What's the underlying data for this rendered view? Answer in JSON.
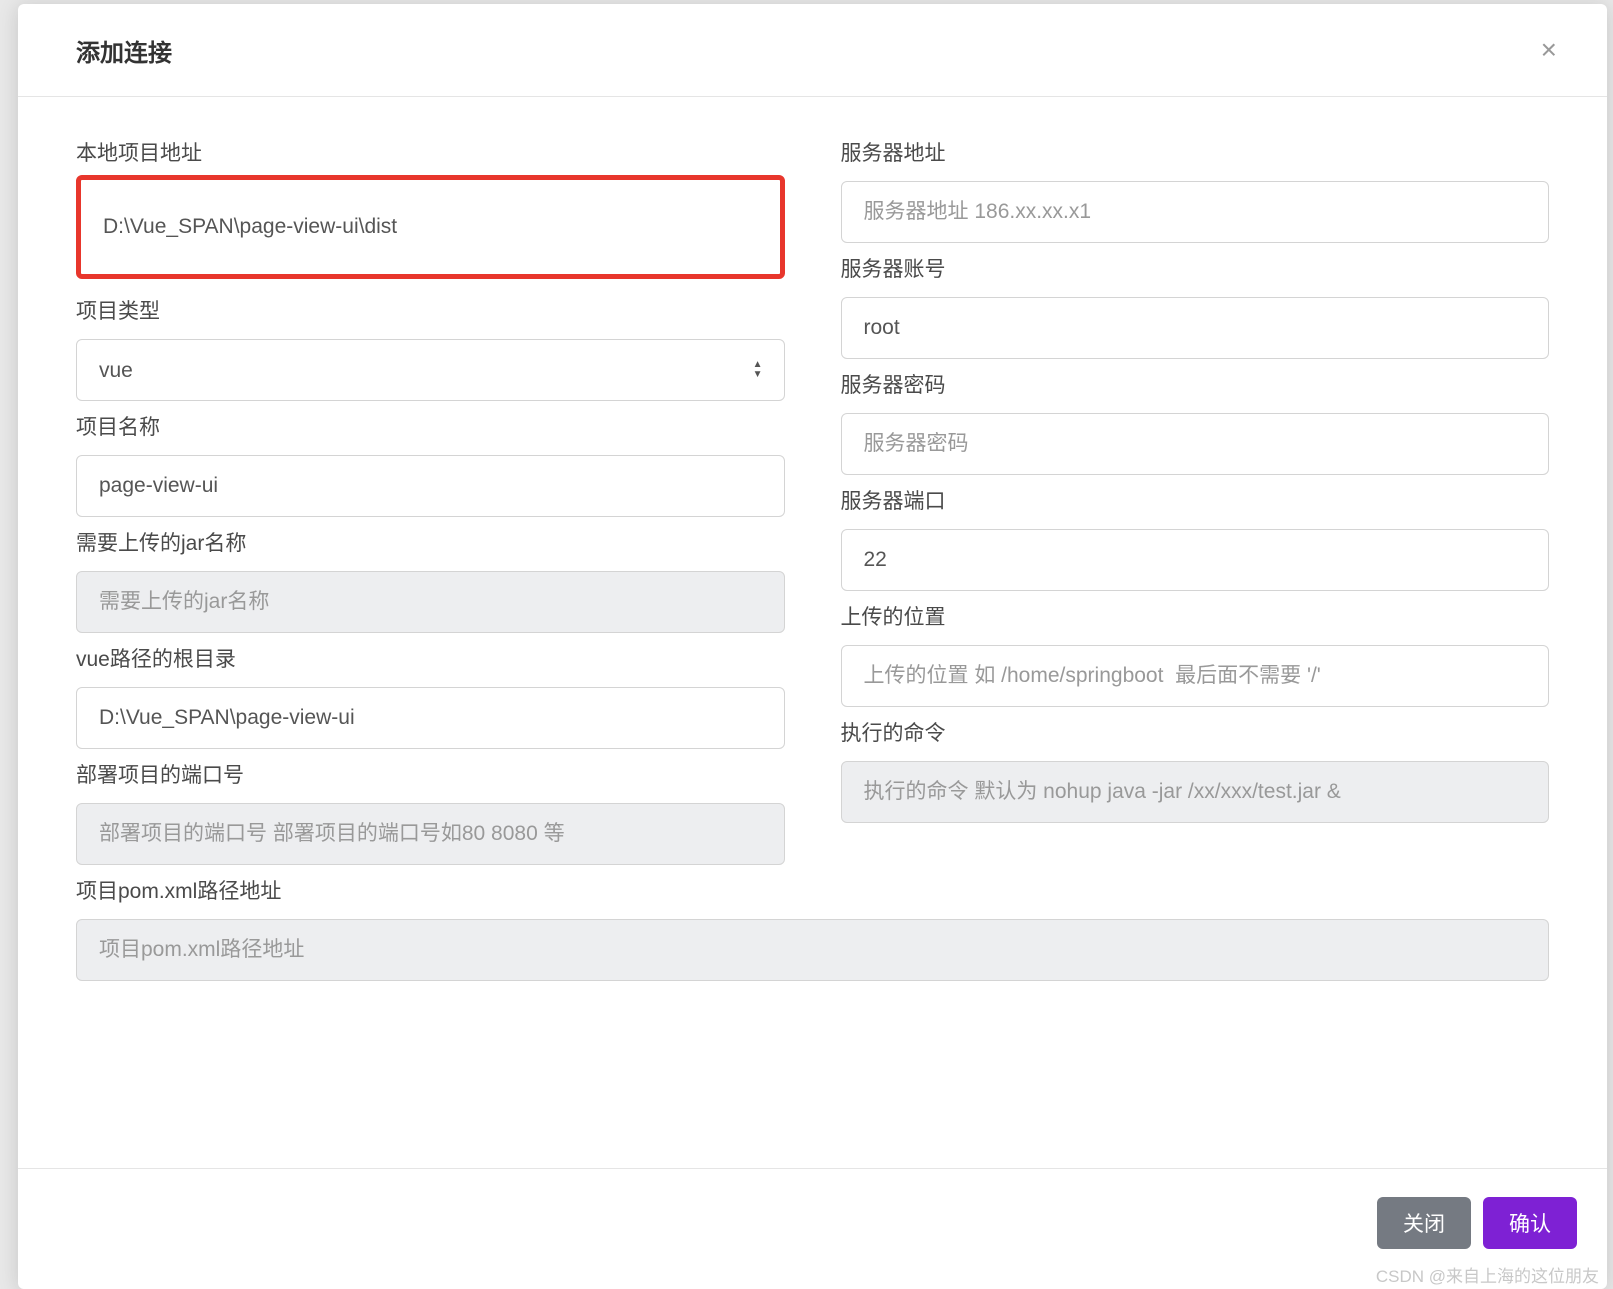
{
  "modal": {
    "title": "添加连接",
    "close_label": "×"
  },
  "left": {
    "local_path": {
      "label": "本地项目地址",
      "value": "D:\\Vue_SPAN\\page-view-ui\\dist"
    },
    "project_type": {
      "label": "项目类型",
      "value": "vue"
    },
    "project_name": {
      "label": "项目名称",
      "value": "page-view-ui"
    },
    "jar_name": {
      "label": "需要上传的jar名称",
      "placeholder": "需要上传的jar名称"
    },
    "vue_root": {
      "label": "vue路径的根目录",
      "value": "D:\\Vue_SPAN\\page-view-ui"
    },
    "deploy_port": {
      "label": "部署项目的端口号",
      "placeholder": "部署项目的端口号 部署项目的端口号如80 8080 等"
    }
  },
  "right": {
    "server_addr": {
      "label": "服务器地址",
      "placeholder": "服务器地址 186.xx.xx.x1"
    },
    "server_user": {
      "label": "服务器账号",
      "value": "root"
    },
    "server_pass": {
      "label": "服务器密码",
      "placeholder": "服务器密码"
    },
    "server_port": {
      "label": "服务器端口",
      "value": "22"
    },
    "upload_path": {
      "label": "上传的位置",
      "placeholder": "上传的位置 如 /home/springboot  最后面不需要 '/'"
    },
    "exec_cmd": {
      "label": "执行的命令",
      "placeholder": "执行的命令 默认为 nohup java -jar /xx/xxx/test.jar &"
    }
  },
  "full": {
    "pom_path": {
      "label": "项目pom.xml路径地址",
      "placeholder": "项目pom.xml路径地址"
    }
  },
  "footer": {
    "close": "关闭",
    "confirm": "确认"
  },
  "watermark": "CSDN @来自上海的这位朋友"
}
